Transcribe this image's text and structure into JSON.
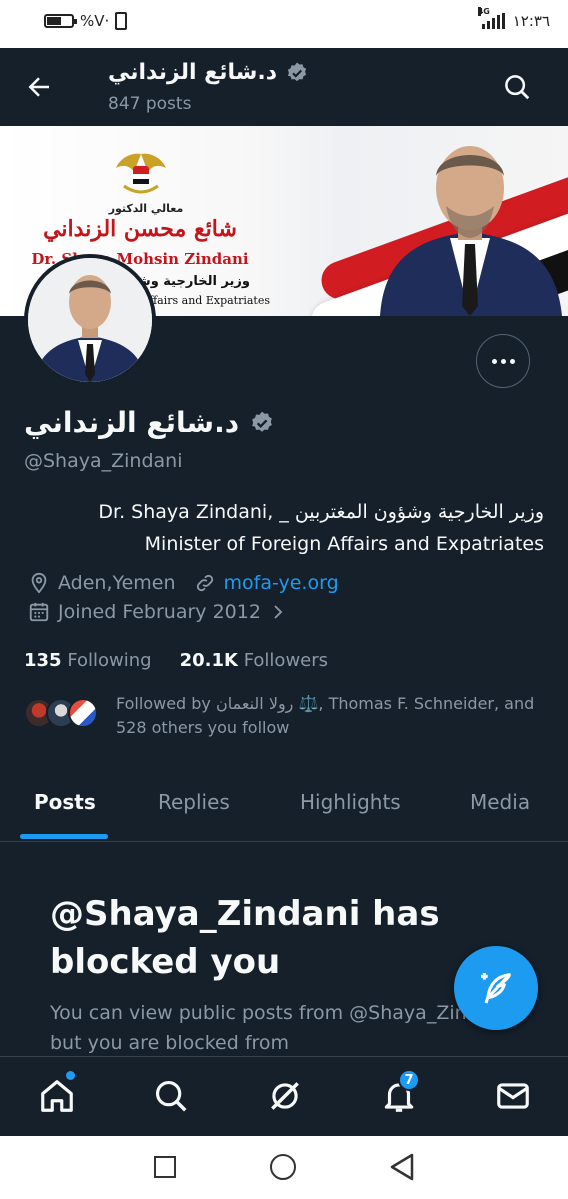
{
  "statusbar": {
    "battery": "%V·",
    "time": "١٢:٣٦",
    "network": "4G"
  },
  "header": {
    "title": "د.شائع الزنداني",
    "post_count": "847 posts"
  },
  "banner": {
    "title_small": "معالي الدكتور",
    "name_ar": "شائع محسن الزنداني",
    "name_en": "Dr. Shaya Mohsin Zindani",
    "minister_ar": "وزير الخارجية وشـ",
    "minister_en": "ffairs and Expatriates"
  },
  "profile": {
    "name": "د.شائع الزنداني",
    "handle": "@Shaya_Zindani",
    "bio_line1": "Dr. Shaya Zindani, _ وزير الخارجية وشؤون المغتربين",
    "bio_line2": "Minister of Foreign Affairs and Expatriates",
    "location": "Aden,Yemen",
    "website": "mofa-ye.org",
    "joined": "Joined February 2012",
    "following_count": "135",
    "following_label": "Following",
    "followers_count": "20.1K",
    "followers_label": "Followers",
    "followed_by": "Followed by رولا النعمان ⚖️, Thomas F. Schneider, and 528 others you follow"
  },
  "tabs": [
    {
      "label": "Posts",
      "active": true
    },
    {
      "label": "Replies",
      "active": false
    },
    {
      "label": "Highlights",
      "active": false
    },
    {
      "label": "Media",
      "active": false
    }
  ],
  "blocked": {
    "title": "@Shaya_Zindani has blocked you",
    "body": "You can view public posts from @Shaya_Zindani, but you are blocked from"
  },
  "bottomnav": {
    "notifications_badge": "7"
  },
  "colors": {
    "background": "#15202b",
    "accent": "#1d9bf0",
    "muted": "#8b98a5",
    "text": "#f7f9f9"
  },
  "icons": [
    "back-arrow-icon",
    "search-icon",
    "verified-badge-icon",
    "location-icon",
    "link-icon",
    "calendar-icon",
    "chevron-right-icon",
    "more-icon",
    "compose-icon",
    "home-icon",
    "grok-icon",
    "bell-icon",
    "mail-icon"
  ]
}
